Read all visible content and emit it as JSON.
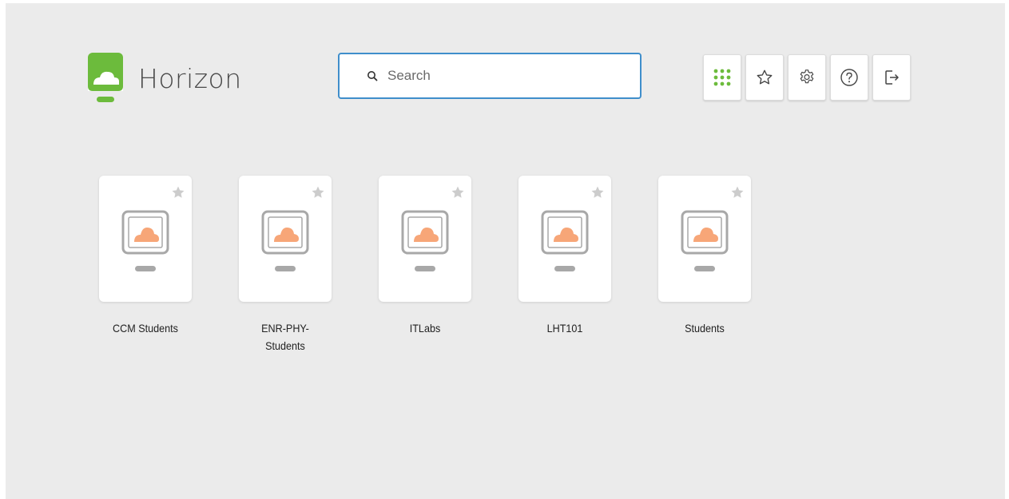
{
  "brand": {
    "name": "Horizon",
    "accent": "#6cbb3c"
  },
  "search": {
    "placeholder": "Search",
    "value": "",
    "border_color": "#3f8ecb"
  },
  "toolbar": {
    "buttons": [
      {
        "name": "app-grid",
        "icon": "grid-icon",
        "color": "#6cbb3c"
      },
      {
        "name": "favorites",
        "icon": "star-outline-icon"
      },
      {
        "name": "settings",
        "icon": "gear-icon"
      },
      {
        "name": "help",
        "icon": "help-circle-icon"
      },
      {
        "name": "logout",
        "icon": "logout-icon"
      }
    ]
  },
  "desktops": [
    {
      "label": "CCM Students",
      "icon": "desktop-cloud-icon",
      "favorite_icon": "star-icon"
    },
    {
      "label": "ENR-PHY-\nStudents",
      "icon": "desktop-cloud-icon",
      "favorite_icon": "star-icon"
    },
    {
      "label": "ITLabs",
      "icon": "desktop-cloud-icon",
      "favorite_icon": "star-icon"
    },
    {
      "label": "LHT101",
      "icon": "desktop-cloud-icon",
      "favorite_icon": "star-icon"
    },
    {
      "label": "Students",
      "icon": "desktop-cloud-icon",
      "favorite_icon": "star-icon"
    }
  ],
  "colors": {
    "background": "#ebebeb",
    "cloud": "#f7a678",
    "monitor": "#a8a8a8",
    "star": "#cccccc"
  }
}
